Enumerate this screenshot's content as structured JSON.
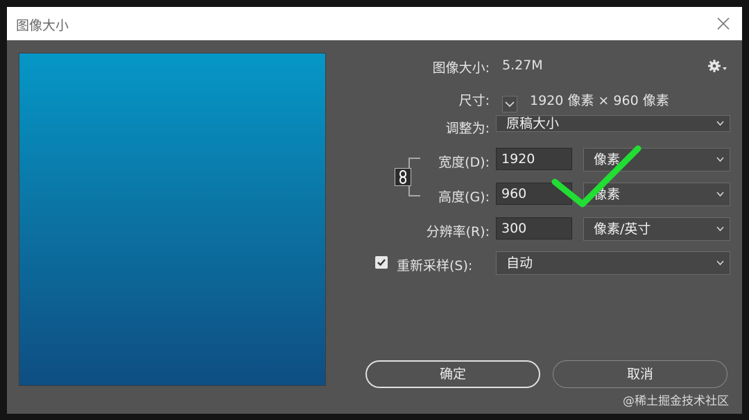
{
  "window": {
    "title": "图像大小"
  },
  "info": {
    "image_size_label": "图像大小:",
    "image_size_value": "5.27M",
    "dimensions_label": "尺寸:",
    "dimensions_value": "1920 像素 × 960 像素"
  },
  "fit_to": {
    "label": "调整为:",
    "value": "原稿大小"
  },
  "width": {
    "label": "宽度(D):",
    "value": "1920",
    "unit": "像素"
  },
  "height": {
    "label": "高度(G):",
    "value": "960",
    "unit": "像素"
  },
  "resolution": {
    "label": "分辨率(R):",
    "value": "300",
    "unit": "像素/英寸"
  },
  "resample": {
    "label": "重新采样(S):",
    "value": "自动",
    "checked": true
  },
  "buttons": {
    "ok": "确定",
    "cancel": "取消"
  },
  "watermark": "@稀土掘金技术社区",
  "icons": [
    "close-icon",
    "gear-icon",
    "link-icon",
    "chevron-down-icon",
    "checkmark-icon"
  ],
  "colors": {
    "dialog_bg": "#535353",
    "annotation_check": "#22dd33"
  }
}
